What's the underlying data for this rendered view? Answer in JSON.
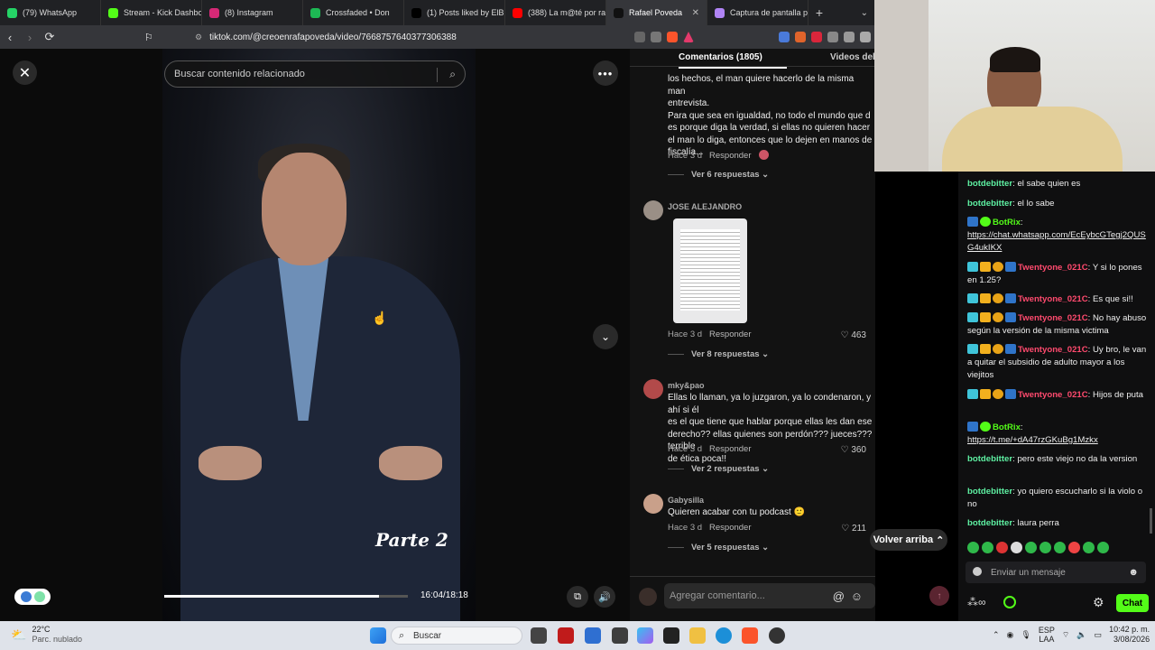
{
  "browser": {
    "tabs": [
      {
        "title": "(79) WhatsApp",
        "color": "#25d366"
      },
      {
        "title": "Stream - Kick Dashbo",
        "color": "#53fc18"
      },
      {
        "title": "(8) Instagram",
        "color": "#d62976"
      },
      {
        "title": "Crossfaded • Don",
        "color": "#1db954"
      },
      {
        "title": "(1) Posts liked by ElBit",
        "color": "#000000"
      },
      {
        "title": "(388) La m@té por rat",
        "color": "#ff0000"
      },
      {
        "title": "Rafael Poveda",
        "color": "#111111",
        "active": true
      },
      {
        "title": "Captura de pantalla p",
        "color": "#b084f5"
      }
    ],
    "new_tab": "+",
    "url": "tiktok.com/@creoenrafapoveda/video/7668757640377306388"
  },
  "video": {
    "search_placeholder": "Buscar contenido relacionado",
    "overlay_text": "Parte 2",
    "time": "16:04/18:18",
    "progress": 0.88
  },
  "comments": {
    "tab_comments": "Comentarios (1805)",
    "tab_videos": "Videos del",
    "items": [
      {
        "text": "los hechos, el man quiere hacerlo de la misma man entrevista. Para que sea en igualdad, no todo el mundo que d es porque diga la verdad, si ellas no quieren hacer el man lo diga, entonces que lo dejen en manos de fiscalía...",
        "line1": "los hechos, el man quiere hacerlo de la misma man",
        "line2": "entrevista.",
        "line3": "Para que sea en igualdad, no todo el mundo que d",
        "line4": "es porque diga la verdad, si ellas no quieren hacer",
        "line5": "el man lo diga, entonces que lo dejen en manos de",
        "line6": "fiscalía...",
        "time": "Hace 3 d",
        "reply": "Responder",
        "replies": "Ver 6 respuestas"
      },
      {
        "user": "JOSE ALEJANDRO",
        "time": "Hace 3 d",
        "reply": "Responder",
        "likes": "463",
        "replies": "Ver 8 respuestas"
      },
      {
        "user": "mky&pao",
        "line1": "Ellas lo llaman, ya lo juzgaron, ya lo condenaron, y ahí si él",
        "line2": "es el que tiene que hablar porque ellas les dan ese",
        "line3": "derecho?? ellas quienes son perdón??? jueces??? terrible",
        "line4": "de ética poca!!",
        "time": "Hace 3 d",
        "reply": "Responder",
        "likes": "360",
        "replies": "Ver 2 respuestas"
      },
      {
        "user": "Gabysilla",
        "text": "Quieren acabar con tu podcast 🙂",
        "time": "Hace 3 d",
        "reply": "Responder",
        "likes": "211",
        "replies": "Ver 5 respuestas"
      }
    ],
    "scroll_top": "Volver arriba",
    "input_placeholder": "Agregar comentario..."
  },
  "chat": {
    "messages": [
      {
        "user": "botdebitter",
        "color": "#5ef0a2",
        "text": ": el sabe quien es"
      },
      {
        "user": "botdebitter",
        "color": "#5ef0a2",
        "text": ": el lo sabe"
      },
      {
        "user": "BotRix",
        "color": "#53fc18",
        "text": ":"
      },
      {
        "link": "https://chat.whatsapp.com/EcEybcGTegj2QUSG4ukIKX"
      },
      {
        "user": "Twentyone_021C",
        "color": "#ff4a6e",
        "text": ": Y si lo pones en 1.25?"
      },
      {
        "user": "Twentyone_021C",
        "color": "#ff4a6e",
        "text": ": Es que si!!"
      },
      {
        "user": "Twentyone_021C",
        "color": "#ff4a6e",
        "text": ": No hay abuso según la versión de la misma victima"
      },
      {
        "user": "Twentyone_021C",
        "color": "#ff4a6e",
        "text": ": Uy bro, le van a quitar el subsidio de adulto mayor a los viejitos"
      },
      {
        "user": "Twentyone_021C",
        "color": "#ff4a6e",
        "text": ": Hijos de puta"
      },
      {
        "user": "BotRix",
        "color": "#53fc18",
        "text": ":"
      },
      {
        "link": "https://t.me/+dA47rzGKuBg1Mzkx"
      },
      {
        "user": "botdebitter",
        "color": "#5ef0a2",
        "text": ": pero este viejo no da la version"
      },
      {
        "user": "botdebitter",
        "color": "#5ef0a2",
        "text": ": yo quiero escucharlo si la violo o no"
      },
      {
        "user": "botdebitter",
        "color": "#5ef0a2",
        "text": ": laura perra"
      }
    ],
    "input_placeholder": "Enviar un mensaje",
    "send_label": "Chat"
  },
  "taskbar": {
    "temp": "22°C",
    "weather": "Parc. nublado",
    "search": "Buscar",
    "lang1": "ESP",
    "lang2": "LAA",
    "time": "10:42 p. m.",
    "date": "3/08/2026"
  }
}
